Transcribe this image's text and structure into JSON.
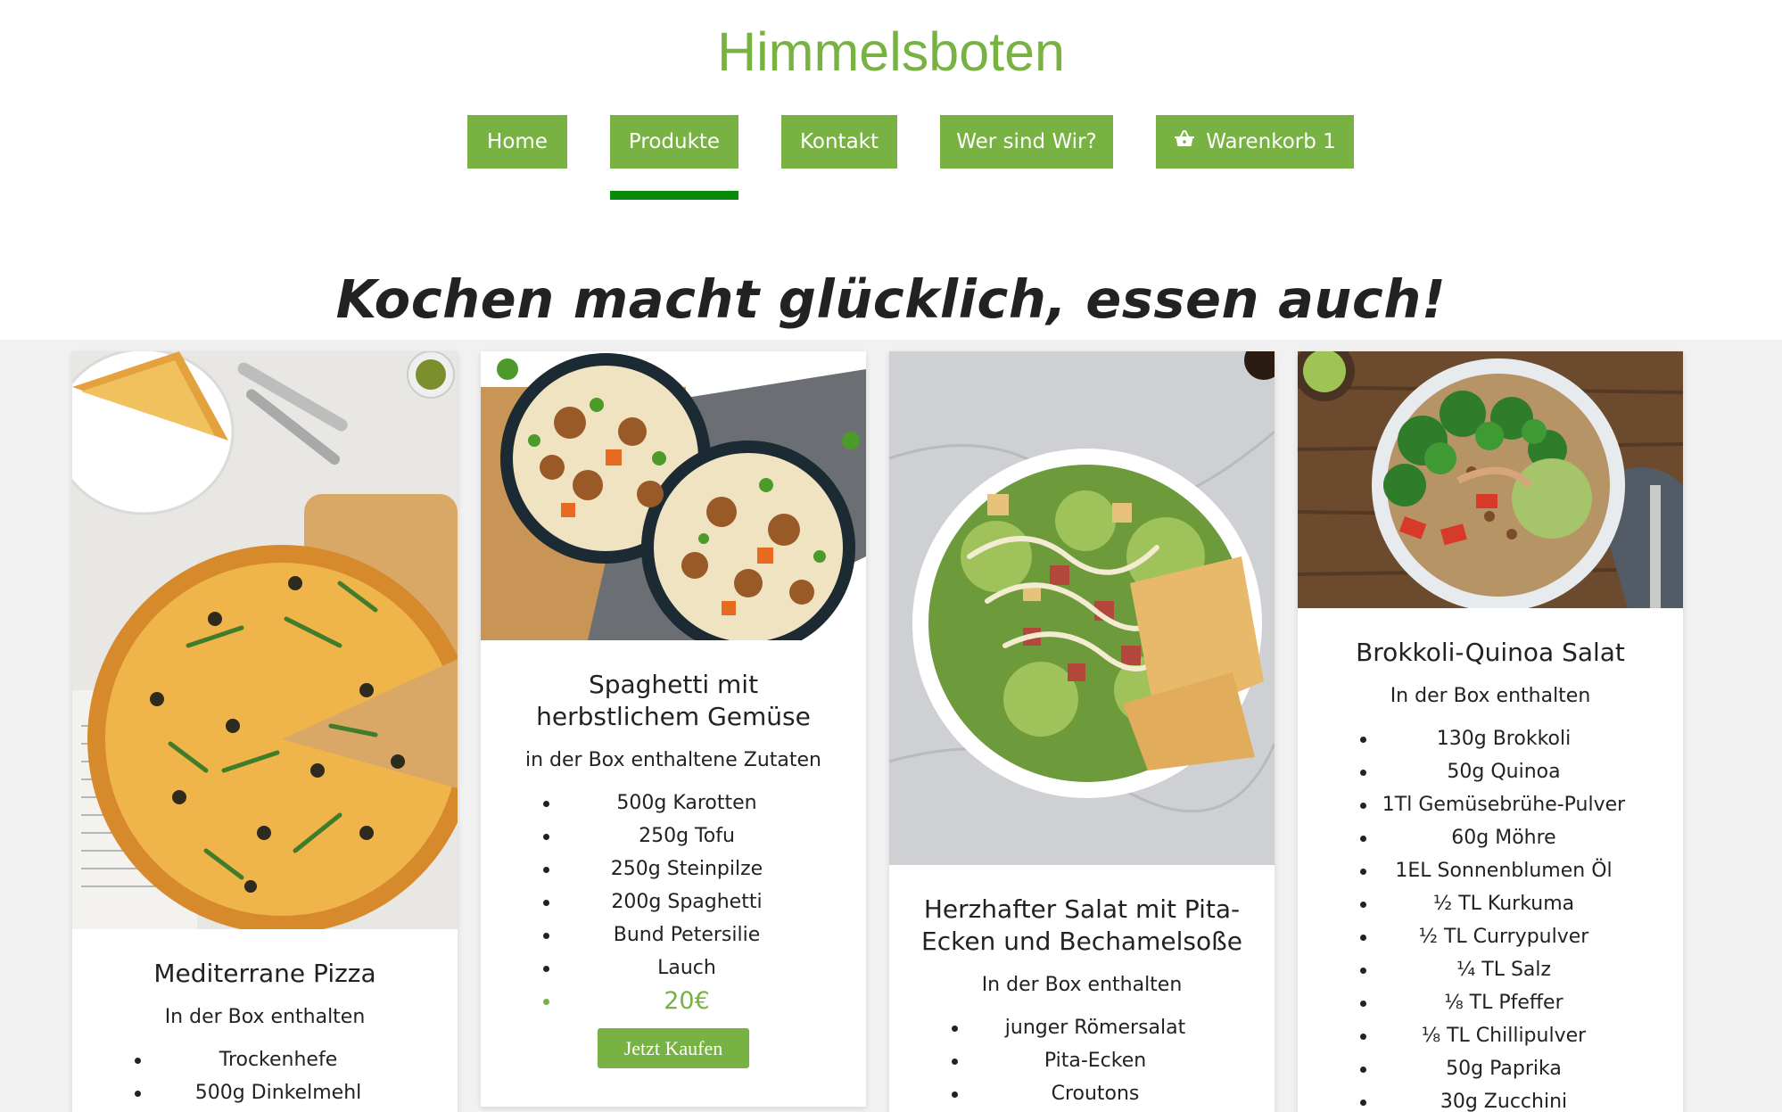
{
  "site": {
    "title": "Himmelsboten",
    "headline": "Kochen macht glücklich, essen auch!"
  },
  "nav": {
    "home": "Home",
    "produkte": "Produkte",
    "kontakt": "Kontakt",
    "wer_sind_wir": "Wer sind Wir?",
    "warenkorb": "Warenkorb 1",
    "active": "Produkte"
  },
  "colors": {
    "brand_green": "#77b243",
    "active_indicator": "#0a8a0a",
    "section_bg": "#f1f1f1"
  },
  "cards": [
    {
      "title": "Mediterrane Pizza",
      "subtitle": "In der Box enthalten",
      "ingredients": [
        "Trockenhefe",
        "500g Dinkelmehl"
      ]
    },
    {
      "title": "Spaghetti mit herbstlichem Gemüse",
      "subtitle": "in der Box enthaltene Zutaten",
      "ingredients": [
        "500g Karotten",
        "250g Tofu",
        "250g Steinpilze",
        "200g Spaghetti",
        "Bund Petersilie",
        "Lauch"
      ],
      "price": "20€",
      "buy_label": "Jetzt Kaufen"
    },
    {
      "title": "Herzhafter Salat mit Pita-Ecken und Bechamelsoße",
      "subtitle": "In der Box enthalten",
      "ingredients": [
        "junger Römersalat",
        "Pita-Ecken",
        "Croutons"
      ]
    },
    {
      "title": "Brokkoli-Quinoa Salat",
      "subtitle": "In der Box enthalten",
      "ingredients": [
        "130g Brokkoli",
        "50g Quinoa",
        "1Tl Gemüsebrühe-Pulver",
        "60g Möhre",
        "1EL Sonnenblumen Öl",
        "½ TL Kurkuma",
        "½ TL Currypulver",
        "¼ TL Salz",
        "⅛ TL Pfeffer",
        "⅛ TL Chillipulver",
        "50g Paprika",
        "30g Zucchini"
      ]
    }
  ]
}
